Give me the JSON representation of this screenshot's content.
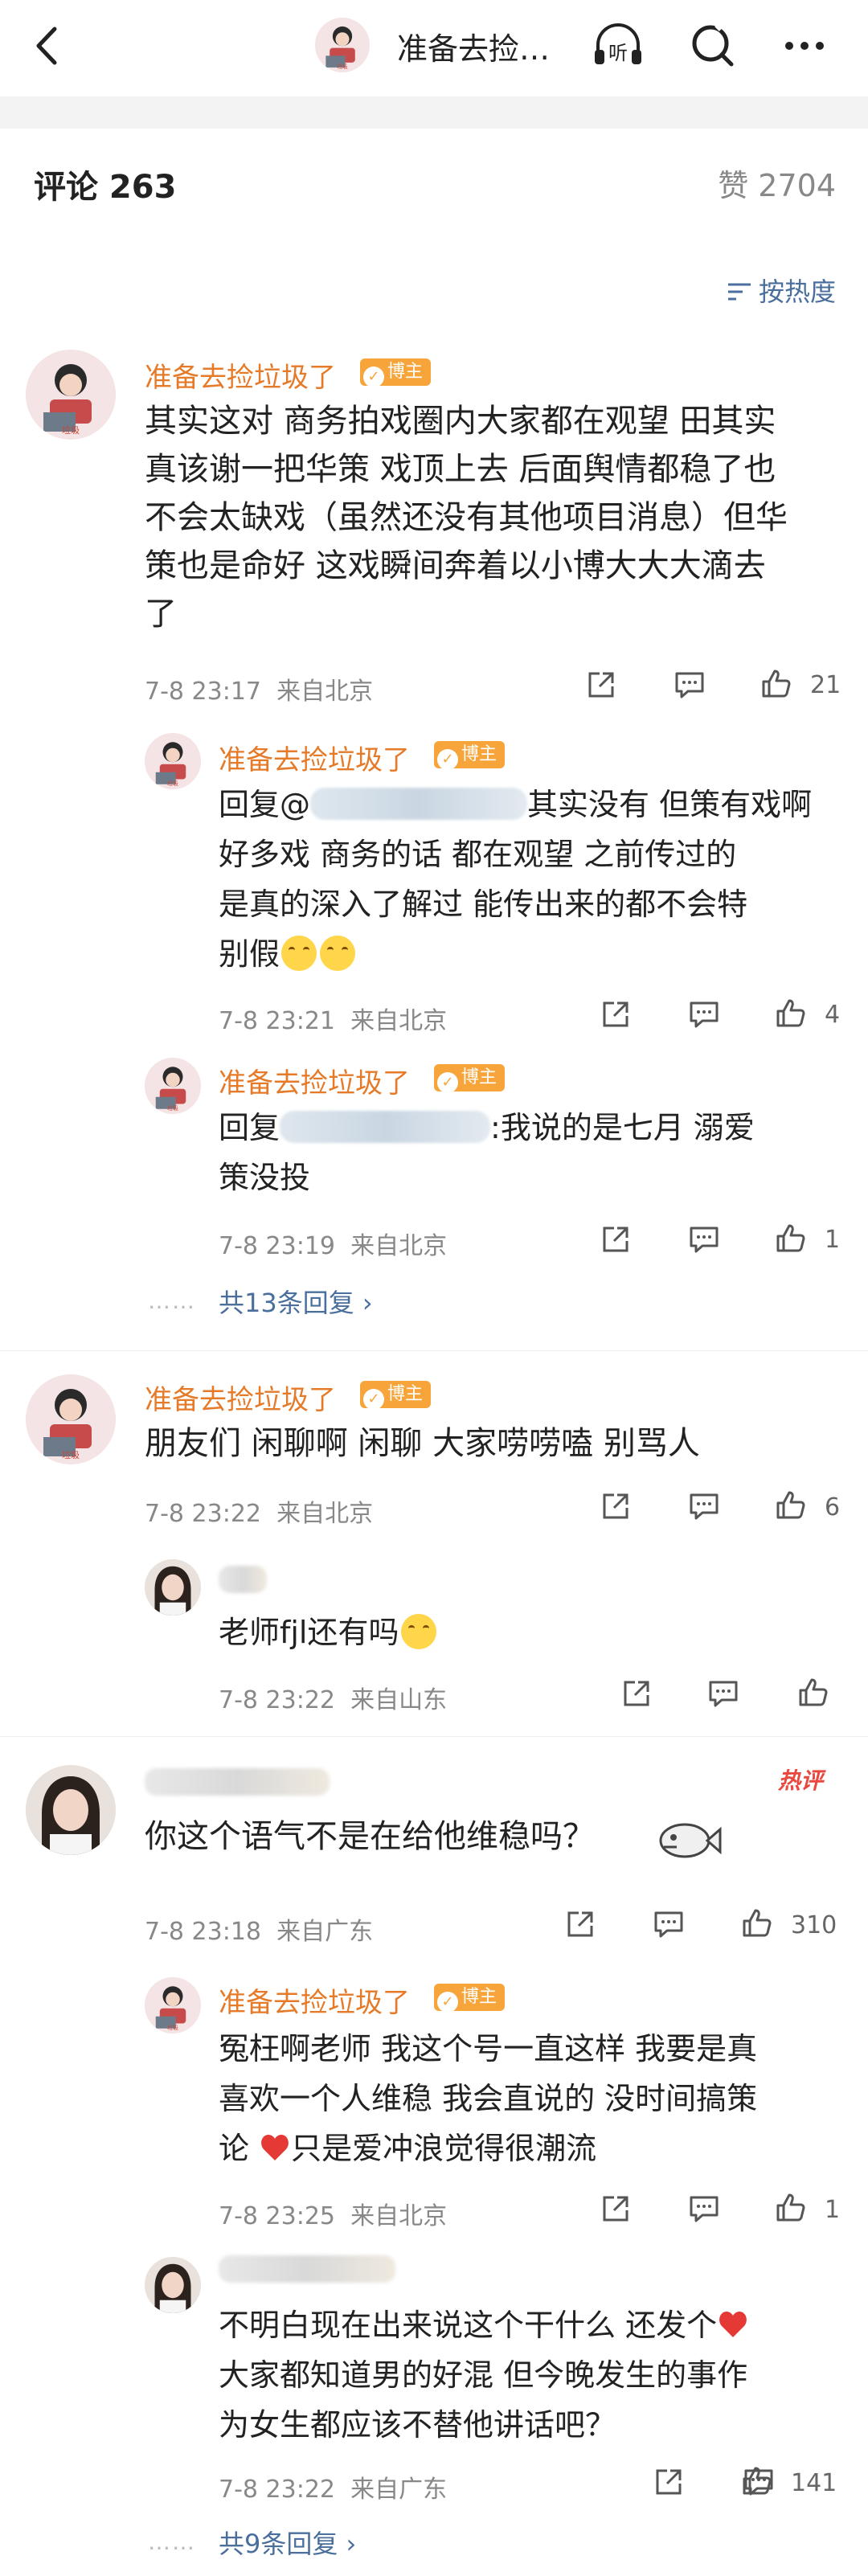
{
  "nav": {
    "title": "准备去捡…",
    "back": "back-arrow",
    "listen": "听"
  },
  "header": {
    "comments": "评论 263",
    "likes": "赞 2704",
    "sort": "按热度"
  },
  "threads": [
    {
      "author": "准备去捡垃圾了",
      "badge": "博主",
      "text": [
        "其实这对 商务拍戏圈内大家都在观望 田其实",
        "真该谢一把华策 戏顶上去 后面舆情都稳了也",
        "不会太缺戏（虽然还没有其他项目消息）但华",
        "策也是命好 这戏瞬间奔着以小博大大大滴去",
        "了"
      ],
      "time": "7-8 23:17",
      "loc": "来自北京",
      "likes": "21",
      "replies": [
        {
          "author": "准备去捡垃圾了",
          "badge": "博主",
          "lines": [
            "回复@",
            "其实没有 但策有戏啊",
            "好多戏 商务的话 都在观望 之前传过的",
            "是真的深入了解过 能传出来的都不会特",
            "别假"
          ],
          "time": "7-8 23:21",
          "loc": "来自北京",
          "likes": "4"
        },
        {
          "author": "准备去捡垃圾了",
          "badge": "博主",
          "lines": [
            "回复",
            ":我说的是七月 溺爱",
            "策没投"
          ],
          "time": "7-8 23:19",
          "loc": "来自北京",
          "likes": "1"
        }
      ],
      "more": "共13条回复"
    },
    {
      "author": "准备去捡垃圾了",
      "badge": "博主",
      "text": [
        "朋友们 闲聊啊 闲聊 大家唠唠嗑 别骂人"
      ],
      "time": "7-8 23:22",
      "loc": "来自北京",
      "likes": "6",
      "replies": [
        {
          "lines": [
            "老师fjl还有吗"
          ],
          "time": "7-8 23:22",
          "loc": "来自山东"
        }
      ]
    },
    {
      "hot": "热评",
      "text": [
        "你这个语气不是在给他维稳吗？"
      ],
      "time": "7-8 23:18",
      "loc": "来自广东",
      "likes": "310",
      "replies": [
        {
          "author": "准备去捡垃圾了",
          "badge": "博主",
          "lines": [
            "冤枉啊老师 我这个号一直这样 我要是真",
            "喜欢一个人维稳 我会直说的 没时间搞策",
            "论",
            "只是爱冲浪觉得很潮流"
          ],
          "time": "7-8 23:25",
          "loc": "来自北京",
          "likes": "1"
        },
        {
          "lines": [
            "不明白现在出来说这个干什么 还发个",
            "大家都知道男的好混 但今晚发生的事作",
            "为女生都应该不替他讲话吧？"
          ],
          "time": "7-8 23:22",
          "loc": "来自广东",
          "likes": "141"
        }
      ],
      "more": "共9条回复"
    }
  ],
  "colors": {
    "name": "#e57a29",
    "link": "#4a6f9c",
    "meta": "#888888",
    "badge": "#f7a53b",
    "hot": "#e8483f"
  }
}
